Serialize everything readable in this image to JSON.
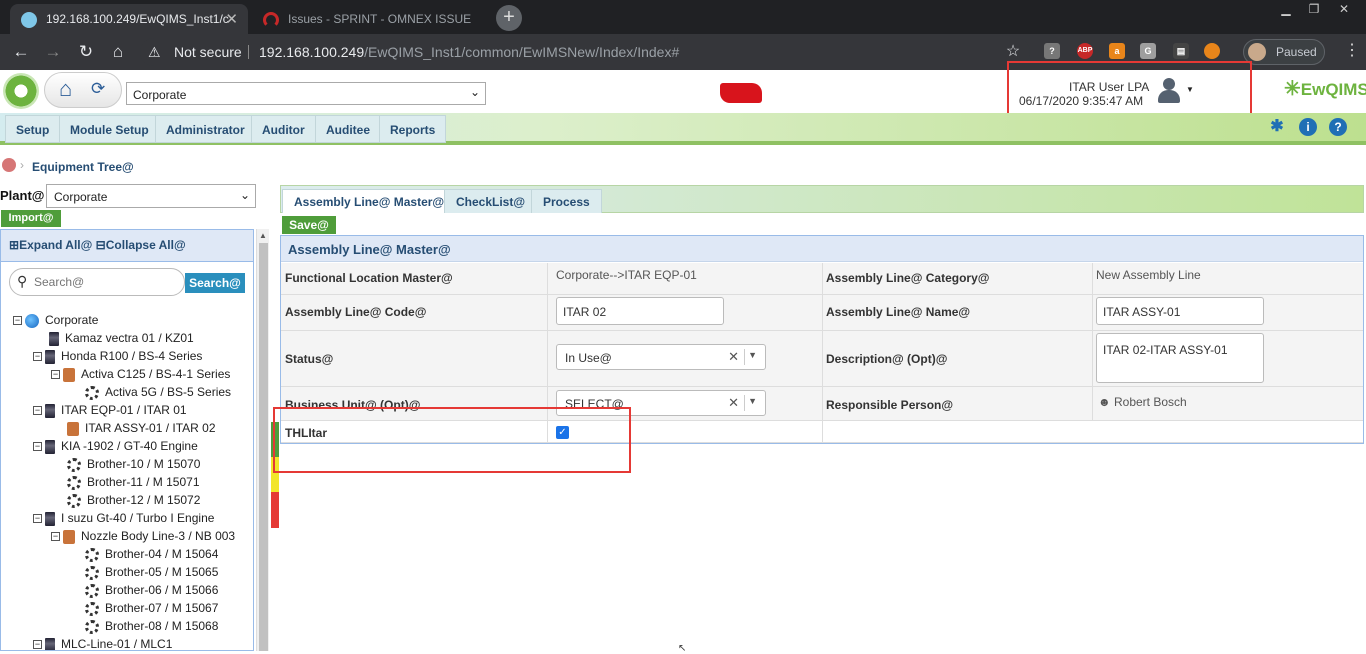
{
  "browser": {
    "tabs": [
      {
        "title": "192.168.100.249/EwQIMS_Inst1/c"
      },
      {
        "title": "Issues - SPRINT - OMNEX ISSUE"
      }
    ],
    "not_secure": "Not secure",
    "url_host": "192.168.100.249",
    "url_path": "/EwQIMS_Inst1/common/EwIMSNew/Index/Index#",
    "profile_status": "Paused"
  },
  "header": {
    "company_select": "Corporate",
    "user_name": "ITAR User LPA",
    "user_datetime": "06/17/2020 9:35:47 AM",
    "brand": "EwQIMS"
  },
  "menu": [
    "Setup",
    "Module Setup",
    "Administrator",
    "Auditor",
    "Auditee",
    "Reports"
  ],
  "breadcrumb": "Equipment Tree@",
  "left": {
    "plant_label": "Plant@",
    "plant_value": "Corporate",
    "import_label": "Import@",
    "expand_label": "Expand All@",
    "collapse_label": "Collapse All@",
    "search_placeholder": "Search@",
    "search_button": "Search@",
    "tree": [
      {
        "label": "Corporate",
        "icon": "globe-icon",
        "toggle": "−"
      },
      {
        "label": "Kamaz vectra 01 / KZ01",
        "icon": "plc-icon",
        "toggle": ""
      },
      {
        "label": "Honda R100 / BS-4 Series",
        "icon": "plc-icon",
        "toggle": "−"
      },
      {
        "label": "Activa C125 / BS-4-1 Series",
        "icon": "box-icon",
        "toggle": "−"
      },
      {
        "label": "Activa 5G / BS-5 Series",
        "icon": "gear-icon",
        "toggle": ""
      },
      {
        "label": "ITAR EQP-01 / ITAR 01",
        "icon": "plc-icon",
        "toggle": "−"
      },
      {
        "label": "ITAR ASSY-01 / ITAR 02",
        "icon": "box-icon",
        "toggle": ""
      },
      {
        "label": "KIA -1902 / GT-40 Engine",
        "icon": "plc-icon",
        "toggle": "−"
      },
      {
        "label": "Brother-10 / M 15070",
        "icon": "gear-icon",
        "toggle": ""
      },
      {
        "label": "Brother-11 / M 15071",
        "icon": "gear-icon",
        "toggle": ""
      },
      {
        "label": "Brother-12 / M 15072",
        "icon": "gear-icon",
        "toggle": ""
      },
      {
        "label": "I suzu Gt-40 / Turbo I Engine",
        "icon": "plc-icon",
        "toggle": "−"
      },
      {
        "label": "Nozzle Body Line-3 / NB 003",
        "icon": "box-icon",
        "toggle": "−"
      },
      {
        "label": "Brother-04 / M 15064",
        "icon": "gear-icon",
        "toggle": ""
      },
      {
        "label": "Brother-05 / M 15065",
        "icon": "gear-icon",
        "toggle": ""
      },
      {
        "label": "Brother-06 / M 15066",
        "icon": "gear-icon",
        "toggle": ""
      },
      {
        "label": "Brother-07 / M 15067",
        "icon": "gear-icon",
        "toggle": ""
      },
      {
        "label": "Brother-08 / M 15068",
        "icon": "gear-icon",
        "toggle": ""
      },
      {
        "label": "MLC-Line-01 / MLC1",
        "icon": "plc-icon",
        "toggle": "−"
      }
    ]
  },
  "content": {
    "tabs": [
      "Assembly Line@ Master@",
      "CheckList@",
      "Process"
    ],
    "save_label": "Save@",
    "panel_title": "Assembly Line@ Master@",
    "fields": {
      "functional_location_label": "Functional Location Master@",
      "functional_location_value": "Corporate-->ITAR EQP-01",
      "category_label": "Assembly Line@ Category@",
      "category_value": "New Assembly Line",
      "code_label": "Assembly Line@ Code@",
      "code_value": "ITAR 02",
      "name_label": "Assembly Line@ Name@",
      "name_value": "ITAR ASSY-01",
      "status_label": "Status@",
      "status_value": "In Use@",
      "description_label": "Description@ (Opt)@",
      "description_value": "ITAR 02-ITAR ASSY-01",
      "business_unit_label": "Business Unit@ (Opt)@",
      "business_unit_value": "SELECT@",
      "responsible_label": "Responsible Person@",
      "responsible_value": "Robert Bosch",
      "thlitar_label": "THLItar",
      "thlitar_checked": true
    }
  },
  "colors": {
    "accent_green": "#4f9d3a",
    "nav_blue": "#264d73",
    "highlight_red": "#e53935"
  }
}
